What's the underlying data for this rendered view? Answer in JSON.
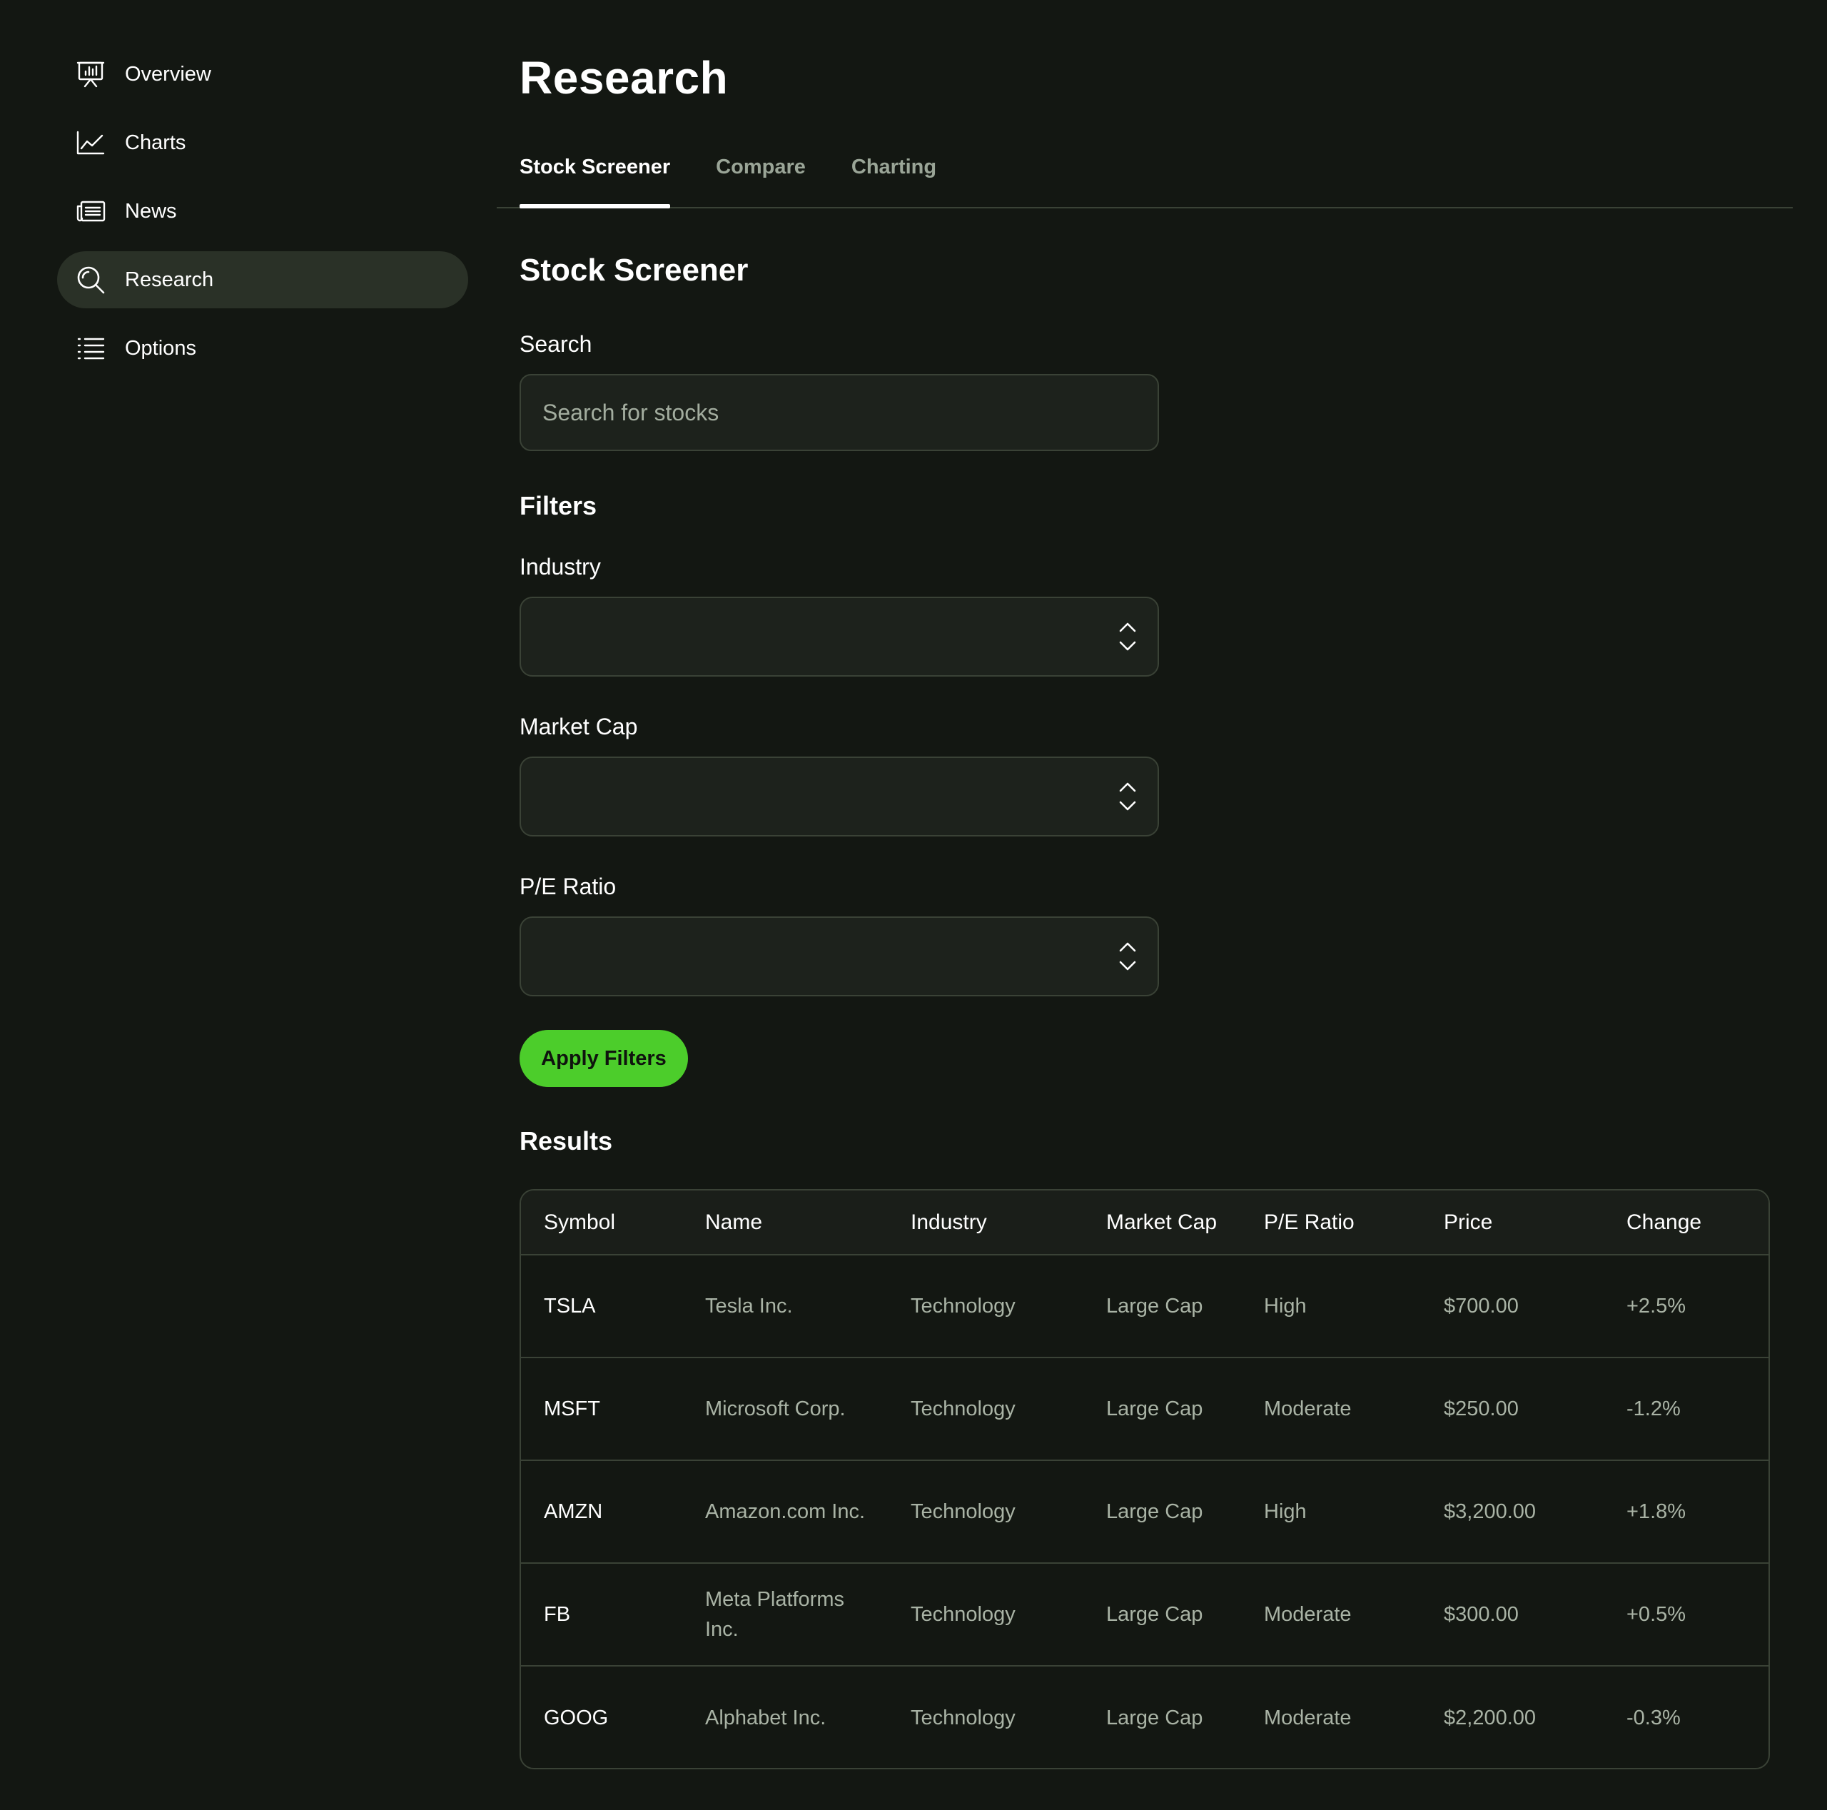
{
  "sidebar": {
    "items": [
      {
        "label": "Overview",
        "icon": "presentation-chart-icon"
      },
      {
        "label": "Charts",
        "icon": "line-chart-icon"
      },
      {
        "label": "News",
        "icon": "newspaper-icon"
      },
      {
        "label": "Research",
        "icon": "search-icon",
        "active": true
      },
      {
        "label": "Options",
        "icon": "list-icon"
      }
    ]
  },
  "page": {
    "title": "Research"
  },
  "tabs": [
    {
      "label": "Stock Screener",
      "active": true
    },
    {
      "label": "Compare"
    },
    {
      "label": "Charting"
    }
  ],
  "screener": {
    "title": "Stock Screener",
    "search_label": "Search",
    "search_placeholder": "Search for stocks",
    "search_value": "",
    "filters_heading": "Filters",
    "filters": [
      {
        "label": "Industry",
        "value": ""
      },
      {
        "label": "Market Cap",
        "value": ""
      },
      {
        "label": "P/E Ratio",
        "value": ""
      }
    ],
    "apply_label": "Apply Filters"
  },
  "results": {
    "heading": "Results",
    "columns": [
      "Symbol",
      "Name",
      "Industry",
      "Market Cap",
      "P/E Ratio",
      "Price",
      "Change"
    ],
    "rows": [
      [
        "TSLA",
        "Tesla Inc.",
        "Technology",
        "Large Cap",
        "High",
        "$700.00",
        "+2.5%"
      ],
      [
        "MSFT",
        "Microsoft Corp.",
        "Technology",
        "Large Cap",
        "Moderate",
        "$250.00",
        "-1.2%"
      ],
      [
        "AMZN",
        "Amazon.com Inc.",
        "Technology",
        "Large Cap",
        "High",
        "$3,200.00",
        "+1.8%"
      ],
      [
        "FB",
        "Meta Platforms Inc.",
        "Technology",
        "Large Cap",
        "Moderate",
        "$300.00",
        "+0.5%"
      ],
      [
        "GOOG",
        "Alphabet Inc.",
        "Technology",
        "Large Cap",
        "Moderate",
        "$2,200.00",
        "-0.3%"
      ]
    ]
  },
  "colors": {
    "background": "#131712",
    "accent": "#4ccd2b",
    "active_nav": "#2a3127",
    "border": "#3a4236"
  }
}
